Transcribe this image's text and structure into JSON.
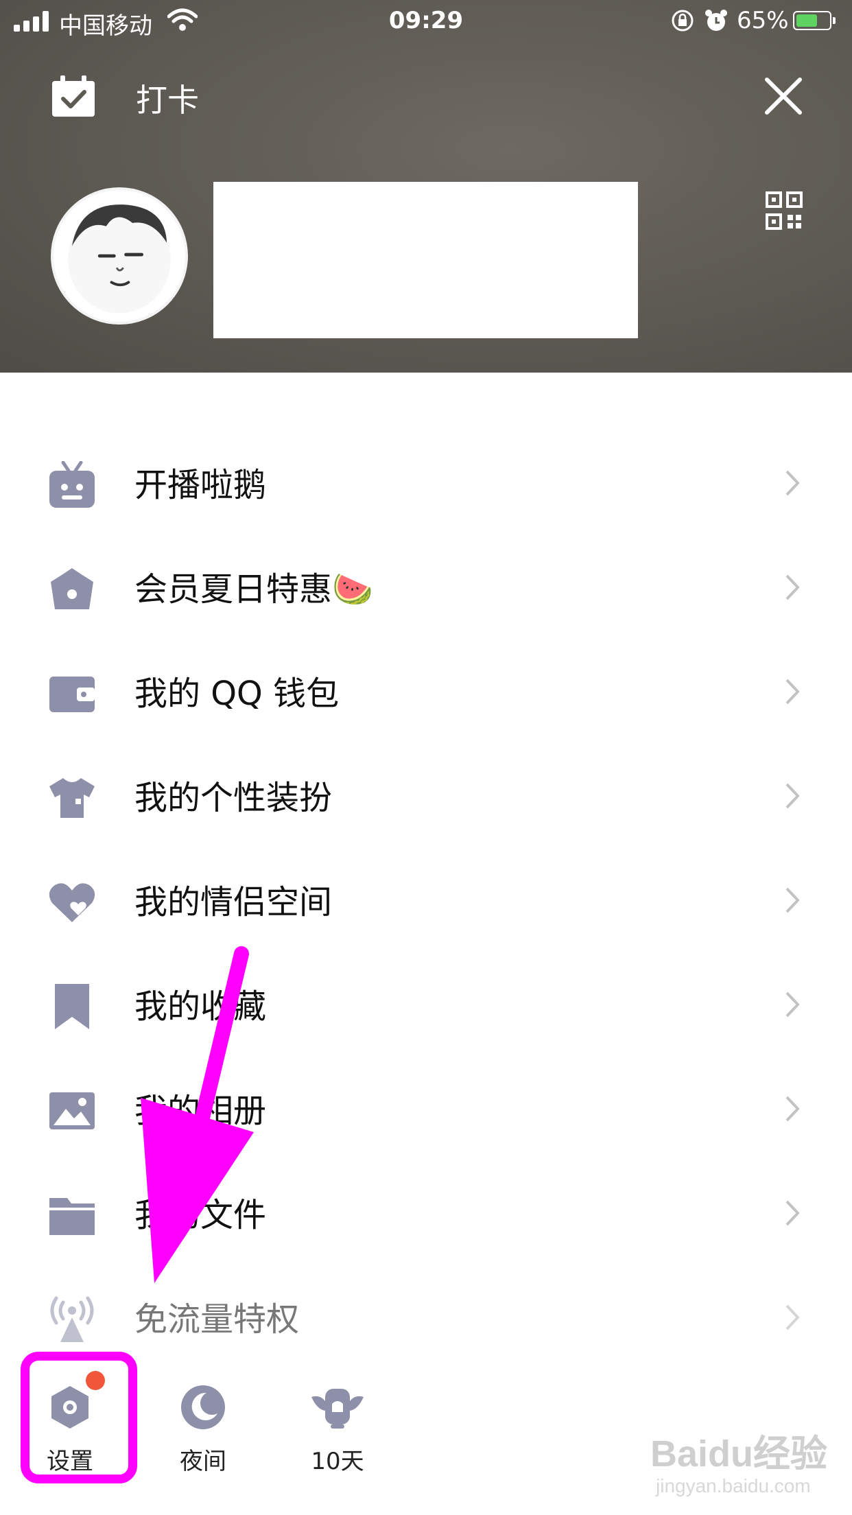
{
  "status_bar": {
    "carrier": "中国移动",
    "time": "09:29",
    "battery_percent": "65%",
    "battery_level": 0.65
  },
  "header": {
    "checkin_label": "打卡"
  },
  "menu": {
    "items": [
      {
        "label": "开播啦鹅",
        "icon": "tv-icon"
      },
      {
        "label": "会员夏日特惠🍉",
        "icon": "crown-icon"
      },
      {
        "label": "我的 QQ 钱包",
        "icon": "wallet-icon"
      },
      {
        "label": "我的个性装扮",
        "icon": "shirt-icon"
      },
      {
        "label": "我的情侣空间",
        "icon": "heart-icon"
      },
      {
        "label": "我的收藏",
        "icon": "bookmark-icon"
      },
      {
        "label": "我的相册",
        "icon": "image-icon"
      },
      {
        "label": "我的文件",
        "icon": "folder-icon"
      },
      {
        "label": "免流量特权",
        "icon": "broadcast-icon"
      }
    ]
  },
  "bottom_bar": {
    "settings_label": "设置",
    "night_label": "夜间",
    "days_label": "10天"
  },
  "watermark": {
    "main": "Baidu经验",
    "sub": "jingyan.baidu.com"
  },
  "colors": {
    "icon": "#8e8fa8",
    "highlight": "#ff00ff",
    "badge": "#f0573a"
  }
}
